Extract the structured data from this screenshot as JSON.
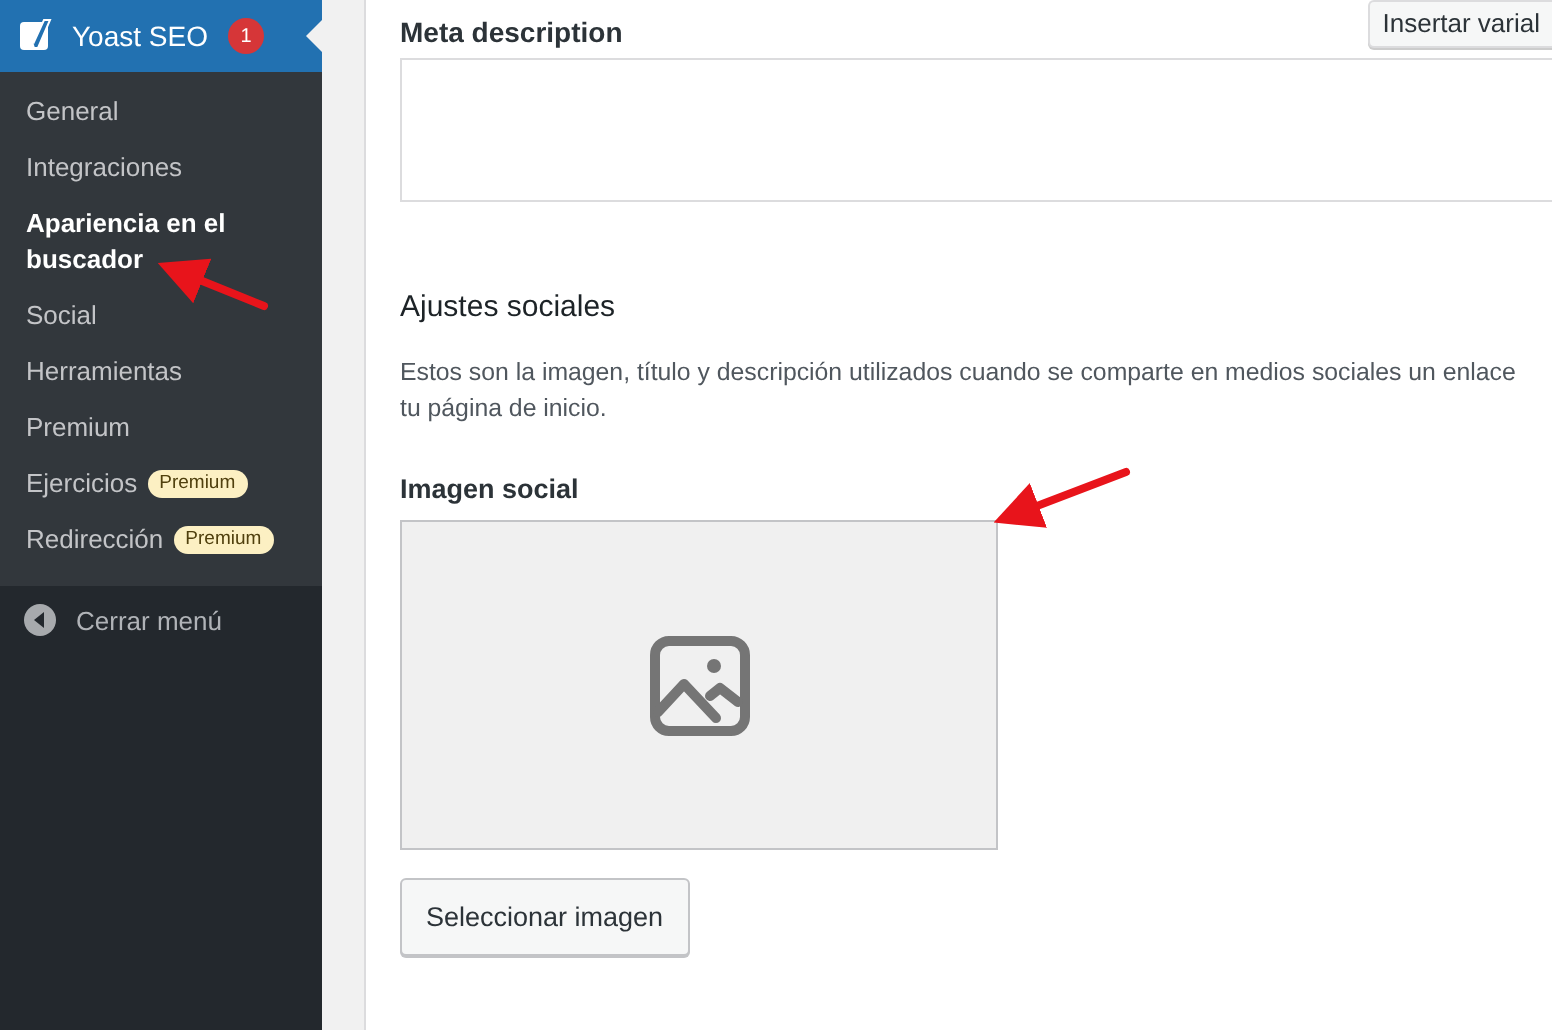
{
  "sidebar": {
    "header": {
      "title": "Yoast SEO",
      "count": "1"
    },
    "items": [
      {
        "label": "General",
        "selected": false
      },
      {
        "label": "Integraciones",
        "selected": false
      },
      {
        "label": "Apariencia en el buscador",
        "selected": true
      },
      {
        "label": "Social",
        "selected": false
      },
      {
        "label": "Herramientas",
        "selected": false
      },
      {
        "label": "Premium",
        "selected": false
      },
      {
        "label": "Ejercicios",
        "selected": false,
        "badge": "Premium"
      },
      {
        "label": "Redirección",
        "selected": false,
        "badge": "Premium"
      }
    ],
    "collapse": "Cerrar menú"
  },
  "content": {
    "meta_description": {
      "label": "Meta description",
      "button": "Insertar varial"
    },
    "social": {
      "heading": "Ajustes sociales",
      "description_lines": [
        "Estos son la imagen, título y descripción utilizados cuando se comparte en medios sociales un enlace",
        "tu página de inicio."
      ],
      "image_label": "Imagen social",
      "select_button": "Seleccionar imagen"
    }
  }
}
